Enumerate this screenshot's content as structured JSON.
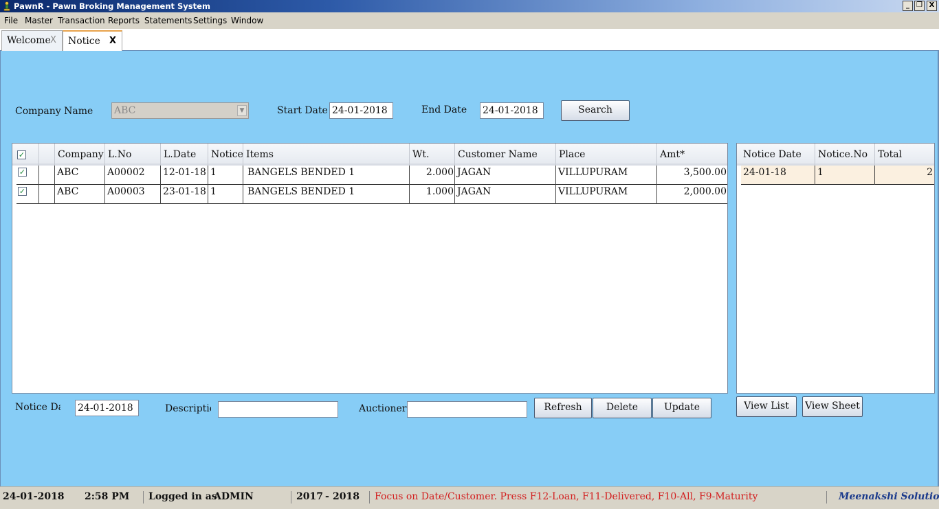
{
  "window": {
    "title": "PawnR - Pawn Broking Management System",
    "buttons": [
      "_",
      "❐",
      "X"
    ]
  },
  "menu": [
    "File",
    "Master",
    "Transaction",
    "Reports",
    "Statements",
    "Settings",
    "Window"
  ],
  "tabs": [
    {
      "label": "Welcome",
      "close": "X"
    },
    {
      "label": "Notice",
      "close": "X"
    }
  ],
  "filters": {
    "company_label": "Company Name",
    "company_value": "ABC",
    "start_label": "Start Date",
    "start_value": "24-01-2018",
    "end_label": "End Date",
    "end_value": "24-01-2018",
    "search_button": "Search"
  },
  "main_grid": {
    "columns": [
      "",
      "",
      "Company",
      "L.No",
      "L.Date",
      "Notice",
      "Items",
      "Wt.",
      "Customer Name",
      "Place",
      "Amt*"
    ],
    "rows": [
      {
        "checked": true,
        "company": "ABC",
        "lno": "A00002",
        "ldate": "12-01-18",
        "notice": "1",
        "items": "BANGELS BENDED 1",
        "wt": "2.000",
        "customer": "JAGAN",
        "place": "VILLUPURAM",
        "amt": "3,500.00"
      },
      {
        "checked": true,
        "company": "ABC",
        "lno": "A00003",
        "ldate": "23-01-18",
        "notice": "1",
        "items": "BANGELS BENDED 1",
        "wt": "1.000",
        "customer": "JAGAN",
        "place": "VILLUPURAM",
        "amt": "2,000.00"
      }
    ]
  },
  "side_grid": {
    "columns": [
      "Notice Date",
      "Notice.No",
      "Total"
    ],
    "rows": [
      {
        "date": "24-01-18",
        "no": "1",
        "total": "2"
      }
    ]
  },
  "footer_form": {
    "notice_date_label": "Notice Date",
    "notice_date_value": "24-01-2018",
    "description_label": "Description",
    "description_value": "",
    "auctioner_label": "Auctioner",
    "auctioner_value": "",
    "refresh_button": "Refresh",
    "delete_button": "Delete",
    "update_button": "Update",
    "view_list_button": "View List",
    "view_sheet_button": "View Sheet"
  },
  "status": {
    "date": "24-01-2018",
    "time": "2:58 PM",
    "login_label": "Logged in as",
    "user": "ADMIN",
    "year_from": "2017",
    "year_sep": "-",
    "year_to": "2018",
    "hint": "Focus on Date/Customer. Press F12-Loan, F11-Delivered, F10-All, F9-Maturity",
    "company": "Meenakshi Solutions"
  },
  "colors": {
    "workarea": "#87cdf6",
    "hint": "#d21f1f",
    "company": "#1a3a8c",
    "side_row": "#fbf0e0",
    "tab_accent": "#e8a24a"
  },
  "icons": {
    "app": "pawn-icon",
    "check": "checkbox-checked-icon",
    "combo": "chevron-down-icon"
  }
}
